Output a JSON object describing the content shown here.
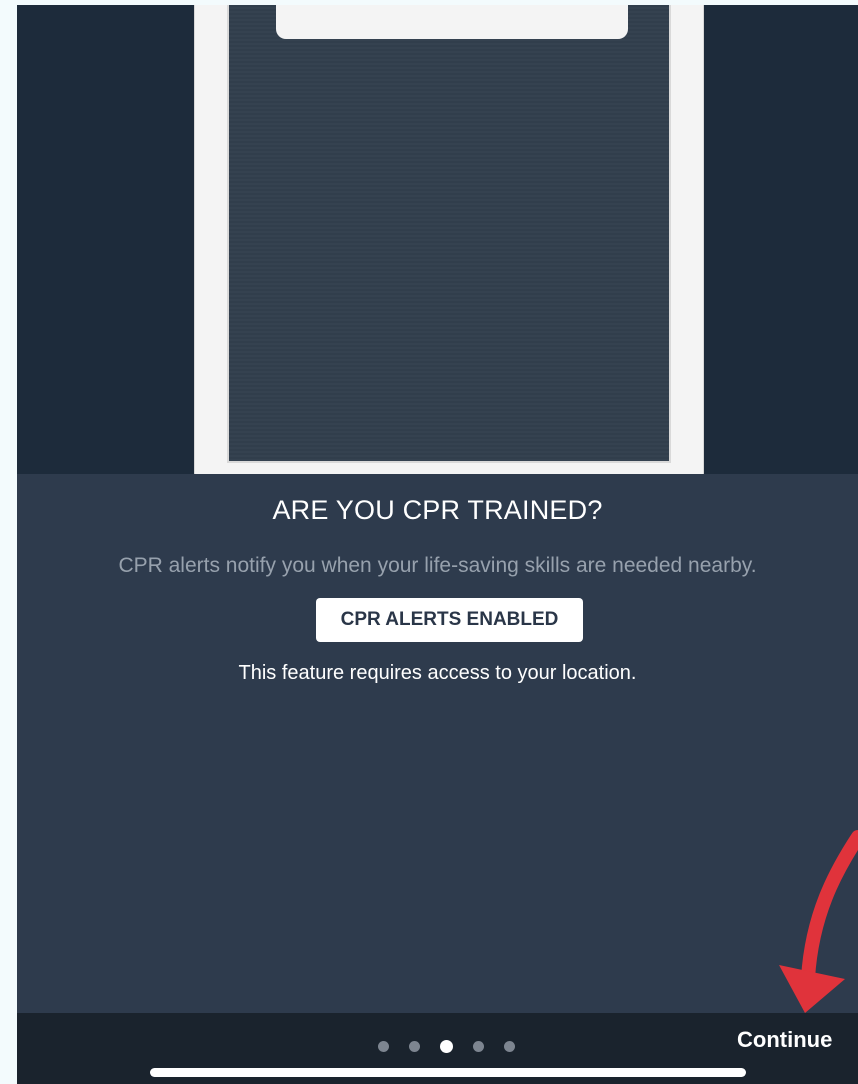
{
  "onboarding": {
    "title": "ARE YOU CPR TRAINED?",
    "subtitle": "CPR alerts notify you when your life-saving skills are needed nearby.",
    "cta_label": "CPR ALERTS ENABLED",
    "note": "This feature requires access to your location."
  },
  "footer": {
    "continue_label": "Continue",
    "page_indicator": {
      "total": 5,
      "current": 3
    }
  },
  "colors": {
    "page_background": "#2e3b4d",
    "hero_background": "#1d2b3b",
    "footer_background": "#1a232d",
    "annotation_arrow": "#e0333b"
  },
  "icons": {
    "heart": "heart-icon",
    "arrow": "annotation-arrow-icon"
  }
}
